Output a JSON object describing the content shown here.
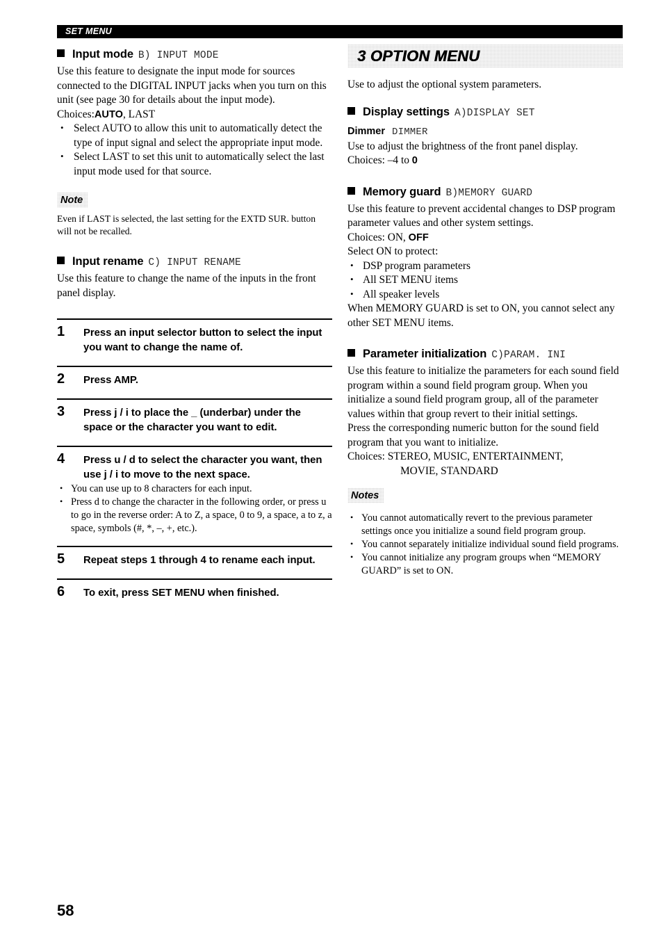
{
  "header": {
    "running_title": "SET MENU"
  },
  "folio": {
    "page_number": "58"
  },
  "left_column": {
    "input_mode": {
      "title": "Input mode",
      "code": "B) INPUT MODE",
      "intro": "Use this feature to designate the input mode for sources connected to the DIGITAL INPUT jacks when you turn on this unit (see page 30 for details about the input mode).",
      "choices_label": "Choices:",
      "choices_bold": "AUTO",
      "choices_rest": ", LAST",
      "bullets": [
        "Select AUTO to allow this unit to automatically detect the type of input signal and select the appropriate input mode.",
        "Select LAST to set this unit to automatically select the last input mode used for that source."
      ]
    },
    "note": {
      "label": "Note",
      "text": "Even if LAST is selected, the last setting for the EXTD SUR. button will not be recalled."
    },
    "input_rename": {
      "title": "Input rename",
      "code": "C) INPUT RENAME",
      "intro": "Use this feature to change the name of the inputs in the front panel display."
    },
    "steps": [
      {
        "number": "1",
        "text": "Press an input selector button to select the input you want to change the name of."
      },
      {
        "number": "2",
        "text": "Press AMP."
      },
      {
        "number": "3",
        "text": "Press j / i to place the _ (underbar) under the space or the character you want to edit."
      },
      {
        "number": "4",
        "text": "Press u / d to select the character you want, then use j / i to move to the next space.",
        "sub_bullets": [
          "You can use up to 8 characters for each input.",
          "Press d to change the character in the following order, or press u to go in the reverse order: A to Z, a space, 0 to 9, a space, a to z, a space, symbols (#, *, –, +, etc.)."
        ]
      },
      {
        "number": "5",
        "text": "Repeat steps 1 through 4 to rename each input."
      },
      {
        "number": "6",
        "text": "To exit, press SET MENU when finished."
      }
    ]
  },
  "right_column": {
    "banner": {
      "title": "3 OPTION MENU"
    },
    "banner_intro": "Use to adjust the optional system parameters.",
    "display_settings": {
      "title": "Display settings",
      "code": "A)DISPLAY SET",
      "dimmer": {
        "title": "Dimmer",
        "code": "DIMMER",
        "text": "Use to adjust the brightness of the front panel display.",
        "choices_label": "Choices: –4 to ",
        "choices_bold": "0"
      }
    },
    "memory_guard": {
      "title": "Memory guard",
      "code": "B)MEMORY GUARD",
      "intro": "Use this feature to prevent accidental changes to DSP program parameter values and other system settings.",
      "choices_label": "Choices: ON, ",
      "choices_bold": "OFF",
      "protect_intro": "Select ON to protect:",
      "protect_items": [
        "DSP program parameters",
        "All SET MENU items",
        "All speaker levels"
      ],
      "outro": "When MEMORY GUARD is set to ON, you cannot select any other SET MENU items."
    },
    "parameter_initialization": {
      "title": "Parameter initialization",
      "code": "C)PARAM. INI",
      "intro": "Use this feature to initialize the parameters for each sound field program within a sound field program group. When you initialize a sound field program group, all of the parameter values within that group revert to their initial settings.",
      "press_text": "Press the corresponding numeric button for the sound field program that you want to initialize.",
      "choices_line1": "Choices: STEREO, MUSIC, ENTERTAINMENT,",
      "choices_line2": "MOVIE, STANDARD"
    },
    "notes": {
      "label": "Notes",
      "items": [
        "You cannot automatically revert to the previous parameter settings once you initialize a sound field program group.",
        "You cannot separately initialize individual sound field programs.",
        "You cannot initialize any program groups when “MEMORY GUARD” is set to ON."
      ]
    }
  }
}
